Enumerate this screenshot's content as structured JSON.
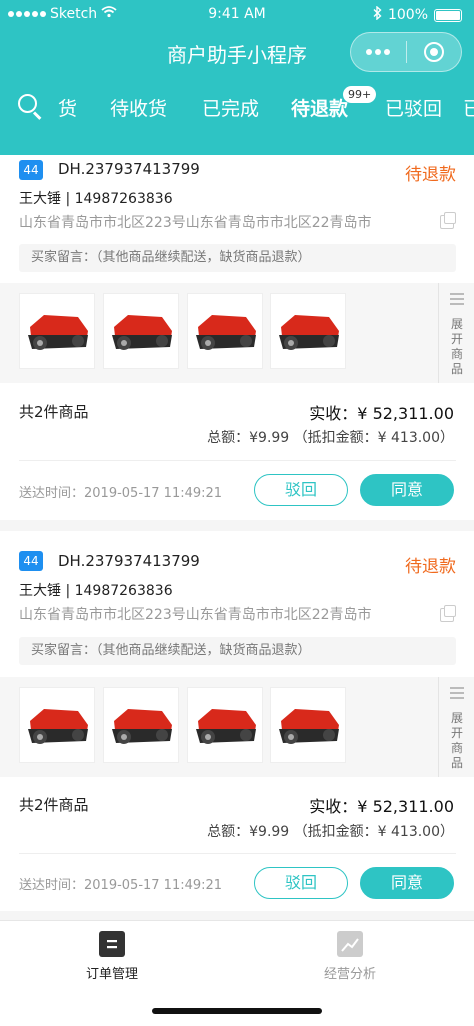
{
  "status_bar": {
    "carrier": "Sketch",
    "time": "9:41 AM",
    "battery": "100%"
  },
  "app": {
    "title": "商户助手小程序"
  },
  "tabs": {
    "items": [
      "货",
      "待收货",
      "已完成",
      "待退款",
      "已驳回",
      "已"
    ],
    "active": "待退款",
    "badge": "99+"
  },
  "orders": [
    {
      "tag": "44",
      "order_no": "DH.237937413799",
      "status": "待退款",
      "buyer": "王大锤 | 14987263836",
      "address": "山东省青岛市市北区223号山东省青岛市市北区22青岛市",
      "memo": "买家留言：（其他商品继续配送，缺货商品退款）",
      "expand_label": "展开商品",
      "count": "共2件商品",
      "paid": "实收：¥ 52,311.00",
      "total": "总额：¥9.99 （抵扣金额：¥ 413.00）",
      "delivery_time": "送达时间：2019-05-17 11:49:21",
      "reject_label": "驳回",
      "approve_label": "同意"
    },
    {
      "tag": "44",
      "order_no": "DH.237937413799",
      "status": "待退款",
      "buyer": "王大锤 | 14987263836",
      "address": "山东省青岛市市北区223号山东省青岛市市北区22青岛市",
      "memo": "买家留言：（其他商品继续配送，缺货商品退款）",
      "expand_label": "展开商品",
      "count": "共2件商品",
      "paid": "实收：¥ 52,311.00",
      "total": "总额：¥9.99 （抵扣金额：¥ 413.00）",
      "delivery_time": "送达时间：2019-05-17 11:49:21",
      "reject_label": "驳回",
      "approve_label": "同意"
    }
  ],
  "tabbar": {
    "items": [
      {
        "label": "订单管理",
        "icon": "order-icon",
        "active": true
      },
      {
        "label": "经营分析",
        "icon": "chart-icon",
        "active": false
      }
    ]
  },
  "colors": {
    "brand": "#2ec4c4",
    "status": "#f06a1e",
    "tag": "#1e8ff0"
  }
}
